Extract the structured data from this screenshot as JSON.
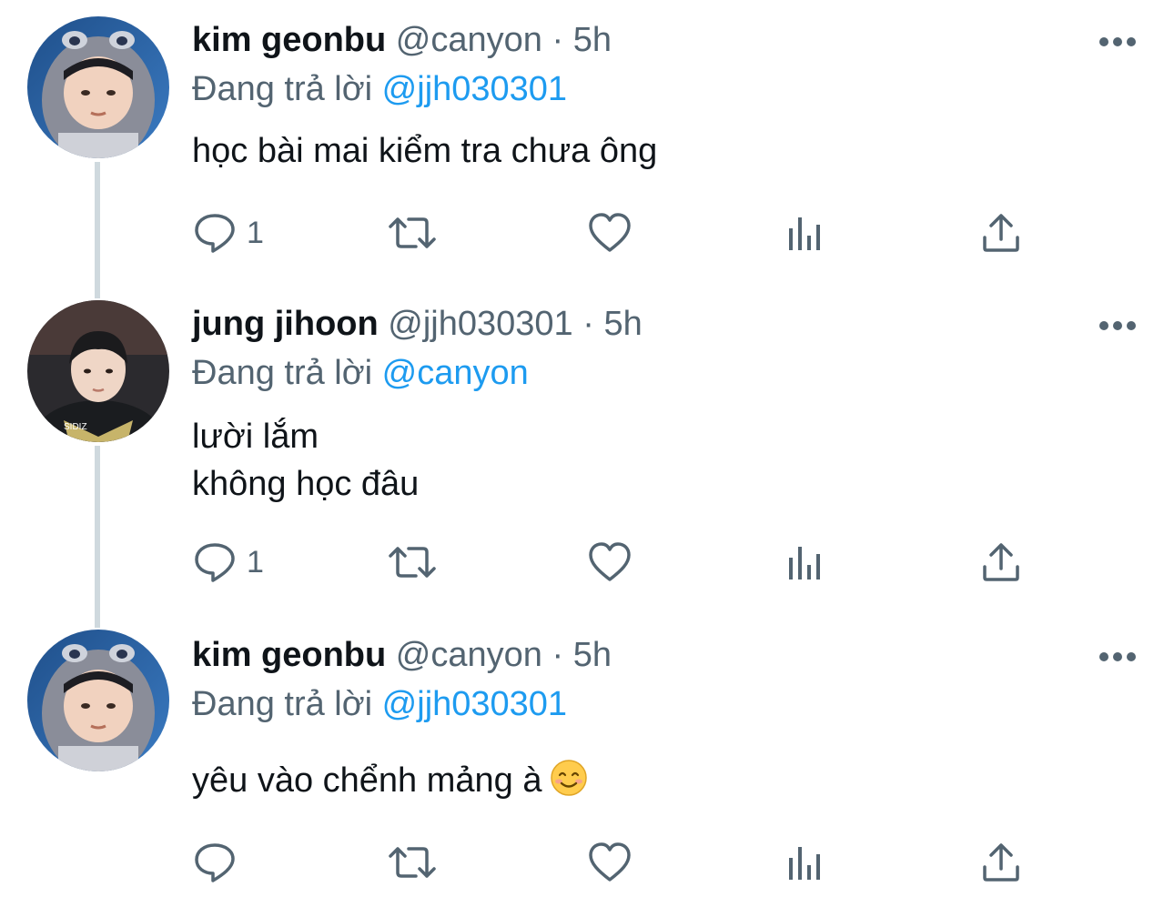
{
  "colors": {
    "text": "#0f1419",
    "secondary": "#536471",
    "link": "#1d9bf0",
    "thread_line": "#cfd9de"
  },
  "tweets": [
    {
      "name": "kim geonbu",
      "handle": "@canyon",
      "separator": "·",
      "time": "5h",
      "reply_prefix": "Đang trả lời",
      "reply_to": "@jjh030301",
      "lines": [
        "học bài mai kiểm tra chưa ông"
      ],
      "reply_count": "1",
      "avatar_icon": "avatar-bunny-hood"
    },
    {
      "name": "jung jihoon",
      "handle": "@jjh030301",
      "separator": "·",
      "time": "5h",
      "reply_prefix": "Đang trả lời",
      "reply_to": "@canyon",
      "lines": [
        "lười lắm",
        "không học đâu"
      ],
      "reply_count": "1",
      "avatar_icon": "avatar-jersey",
      "avatar_jersey_text": "SIDIZ"
    },
    {
      "name": "kim geonbu",
      "handle": "@canyon",
      "separator": "·",
      "time": "5h",
      "reply_prefix": "Đang trả lời",
      "reply_to": "@jjh030301",
      "lines": [
        "yêu vào chểnh mảng à"
      ],
      "emoji": "smiling-face-emoji",
      "reply_count": "",
      "avatar_icon": "avatar-bunny-hood"
    }
  ]
}
